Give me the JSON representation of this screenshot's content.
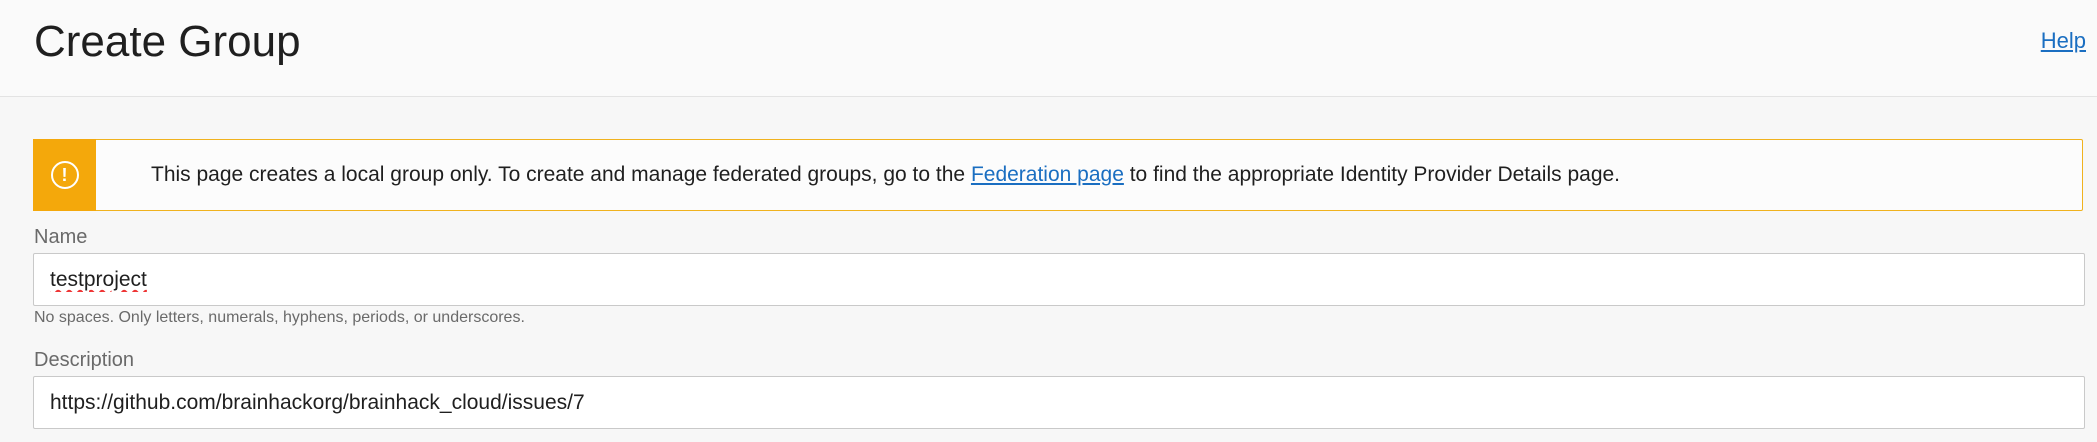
{
  "header": {
    "title": "Create Group",
    "help_label": "Help"
  },
  "notice": {
    "icon": "exclamation-circle-icon",
    "text_before": "This page creates a local group only. To create and manage federated groups, go to the ",
    "link_label": "Federation page",
    "text_after": " to find the appropriate Identity Provider Details page.",
    "accent_color": "#f4a80b"
  },
  "form": {
    "name": {
      "label": "Name",
      "value": "testproject",
      "hint": "No spaces. Only letters, numerals, hyphens, periods, or underscores."
    },
    "description": {
      "label": "Description",
      "value": "https://github.com/brainhackorg/brainhack_cloud/issues/7"
    }
  },
  "colors": {
    "link": "#1a6ec1",
    "warning": "#f4a80b"
  }
}
